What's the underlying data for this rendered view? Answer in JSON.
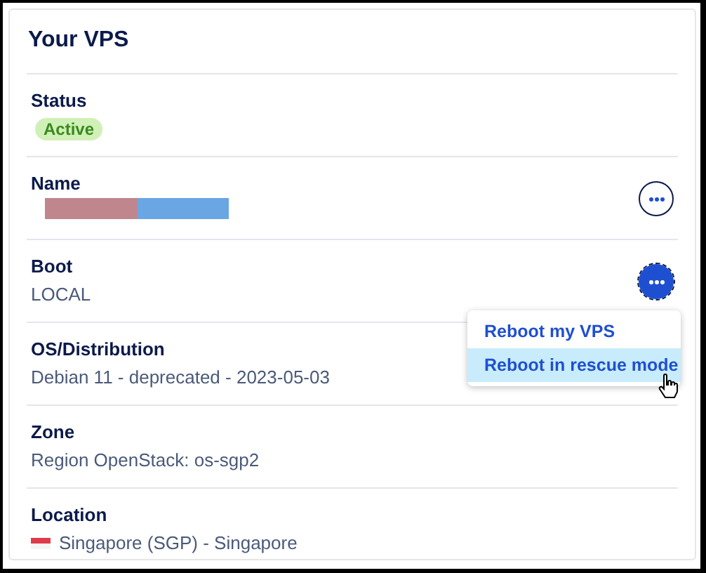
{
  "title": "Your VPS",
  "rows": [
    {
      "label": "Status",
      "kind": "badge",
      "value": "Active"
    },
    {
      "label": "Name",
      "kind": "redacted",
      "menu_button": true,
      "menu_open": false
    },
    {
      "label": "Boot",
      "kind": "text",
      "value": "LOCAL",
      "menu_button": true,
      "menu_open": true,
      "menu": [
        {
          "label": "Reboot my VPS",
          "selected": false
        },
        {
          "label": "Reboot in rescue mode",
          "selected": true
        }
      ]
    },
    {
      "label": "OS/Distribution",
      "kind": "text",
      "value": "Debian 11 - deprecated - 2023-05-03"
    },
    {
      "label": "Zone",
      "kind": "text",
      "value": "Region OpenStack: os-sgp2"
    },
    {
      "label": "Location",
      "kind": "flag",
      "value": "Singapore (SGP) - Singapore"
    }
  ]
}
